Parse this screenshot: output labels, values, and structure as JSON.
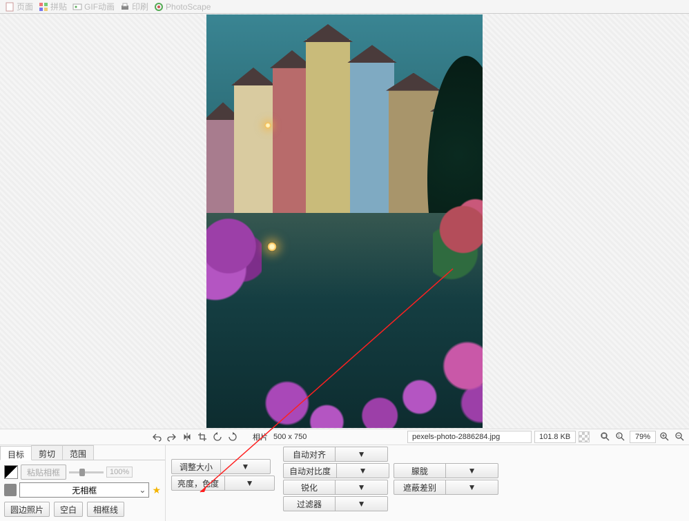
{
  "toolbar": {
    "items": [
      {
        "label": "页面"
      },
      {
        "label": "拼贴"
      },
      {
        "label": "GIF动画"
      },
      {
        "label": "印刷"
      },
      {
        "label": "PhotoScape"
      }
    ]
  },
  "info_bar": {
    "image_label_prefix": "相片",
    "dimensions": "500 x 750",
    "filename": "pexels-photo-2886284.jpg",
    "filesize": "101.8 KB",
    "zoom": "79%"
  },
  "tabs": [
    "目标",
    "剪切",
    "范围"
  ],
  "active_tab": 0,
  "panel": {
    "paste_frame": "粘贴相框",
    "slider_percent": "100%",
    "frame_select": "无相框",
    "round_photo": "圆边照片",
    "blank": "空白",
    "frame_line": "相框线"
  },
  "adjust": {
    "resize": "调整大小",
    "brightness_color": "亮度，色度"
  },
  "auto_col": {
    "auto_align": "自动对齐",
    "auto_contrast": "自动对比度",
    "sharpen": "锐化",
    "filter": "过滤器"
  },
  "effect_col": {
    "blur": "朦胧",
    "mask_diff": "遮蔽差别"
  }
}
